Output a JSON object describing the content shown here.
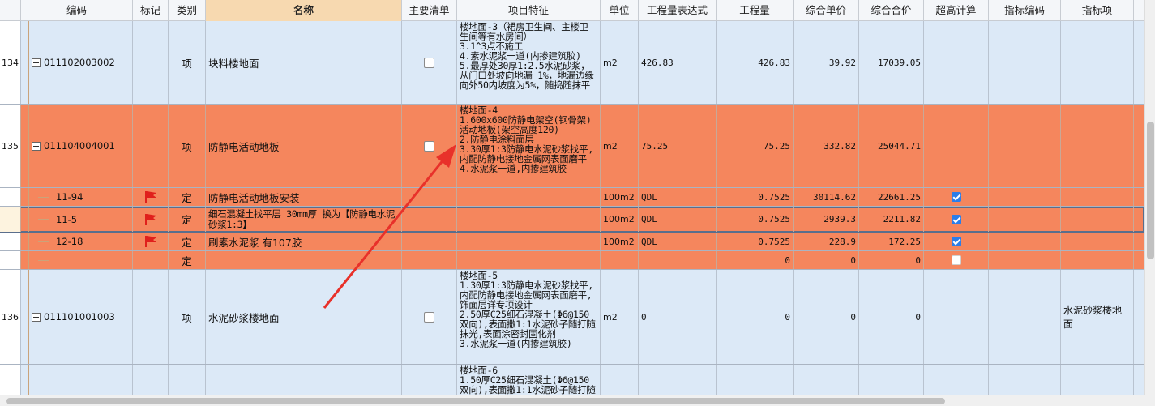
{
  "headers": {
    "code": "编码",
    "mark": "标记",
    "type": "类别",
    "name": "名称",
    "main": "主要清单",
    "feat": "项目特征",
    "unit": "单位",
    "expr": "工程量表达式",
    "qty": "工程量",
    "price": "综合单价",
    "total": "综合合价",
    "high": "超高计算",
    "icode": "指标编码",
    "iitem": "指标项"
  },
  "rows": [
    {
      "num": "134",
      "code": "011102003002",
      "type": "项",
      "name": "块料楼地面",
      "feat": "楼地面-3（裙房卫生间、主楼卫生间等有水房间）\n3.1^3点不施工\n4.素水泥浆一道(内掺建筑胶)\n5.最厚处30厚1:2.5水泥砂浆，从门口处坡向地漏 1%，地漏边缘向外50内坡度为5%，随捣随抹平",
      "unit": "m2",
      "expr": "426.83",
      "qty": "426.83",
      "price": "39.92",
      "total": "17039.05",
      "icode": "",
      "iitem": ""
    },
    {
      "num": "135",
      "code": "011104004001",
      "type": "项",
      "name": "防静电活动地板",
      "feat": "楼地面-4\n1.600x600防静电架空(钢骨架)活动地板(架空高度120)\n2.防静电涂料面层\n3.30厚1:3防静电水泥砂浆找平,内配防静电接地金属网表面磨平\n4.水泥浆一道,内掺建筑胶",
      "unit": "m2",
      "expr": "75.25",
      "qty": "75.25",
      "price": "332.82",
      "total": "25044.71",
      "icode": "",
      "iitem": ""
    },
    {
      "num": "",
      "code": "11-94",
      "type": "定",
      "name": "防静电活动地板安装",
      "feat": "",
      "unit": "100m2",
      "expr": "QDL",
      "qty": "0.7525",
      "price": "30114.62",
      "total": "22661.25",
      "icode": "",
      "iitem": ""
    },
    {
      "num": "",
      "code": "11-5",
      "type": "定",
      "name": "细石混凝土找平层 30mm厚  换为【防静电水泥砂浆1:3】",
      "feat": "",
      "unit": "100m2",
      "expr": "QDL",
      "qty": "0.7525",
      "price": "2939.3",
      "total": "2211.82",
      "icode": "",
      "iitem": ""
    },
    {
      "num": "",
      "code": "12-18",
      "type": "定",
      "name": "刷素水泥浆 有107胶",
      "feat": "",
      "unit": "100m2",
      "expr": "QDL",
      "qty": "0.7525",
      "price": "228.9",
      "total": "172.25",
      "icode": "",
      "iitem": ""
    },
    {
      "num": "",
      "code": "",
      "type": "定",
      "name": "",
      "feat": "",
      "unit": "",
      "expr": "",
      "qty": "0",
      "price": "0",
      "total": "0",
      "icode": "",
      "iitem": ""
    },
    {
      "num": "136",
      "code": "011101001003",
      "type": "项",
      "name": "水泥砂浆楼地面",
      "feat": "楼地面-5\n1.30厚1:3防静电水泥砂浆找平,内配防静电接地金属网表面磨平,饰面层详专项设计\n2.50厚C25细石混凝土(Φ6@150双向),表面撒1:1水泥砂子随打随抹光,表面涂密封固化剂\n3.水泥浆一道(内掺建筑胶)",
      "unit": "m2",
      "expr": "0",
      "qty": "0",
      "price": "0",
      "total": "0",
      "icode": "",
      "iitem": "水泥砂浆楼地面"
    },
    {
      "num": "",
      "code": "",
      "type": "",
      "name": "",
      "feat": "楼地面-6\n1.50厚C25细石混凝土(Φ6@150双向),表面撒1:1水泥砂子随打随",
      "unit": "",
      "expr": "",
      "qty": "",
      "price": "",
      "total": "",
      "icode": "",
      "iitem": ""
    }
  ],
  "colors": {
    "orange": "#f5865d",
    "blue": "#dce9f7",
    "arrow": "#e8312a",
    "check": "#2b7de9",
    "flag": "#e0201c"
  }
}
